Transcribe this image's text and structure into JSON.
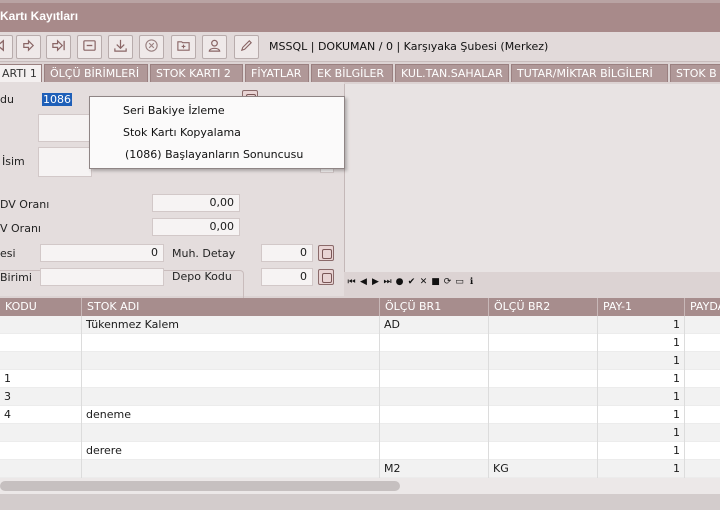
{
  "window": {
    "title": "Kartı Kayıtları"
  },
  "toolbar": {
    "buttons": [
      "back-icon",
      "forward-icon",
      "forward-end-icon",
      "minus-icon",
      "download-icon",
      "cancel-icon",
      "add-icon",
      "user-icon",
      "edit-icon"
    ],
    "info": "MSSQL | DOKUMAN / 0 | Karşıyaka Şubesi (Merkez)"
  },
  "tabs": [
    {
      "label": "ARTI 1",
      "active": true
    },
    {
      "label": "ÖLÇÜ BİRİMLERİ"
    },
    {
      "label": "STOK KARTI 2"
    },
    {
      "label": "FİYATLAR"
    },
    {
      "label": "EK BİLGİLER"
    },
    {
      "label": "KUL.TAN.SAHALAR"
    },
    {
      "label": "TUTAR/MİKTAR BİLGİLERİ"
    },
    {
      "label": "STOK B"
    }
  ],
  "form": {
    "code_label": "du",
    "code_value": "1086",
    "name_label": "İsim",
    "kdv1_label": "DV Oranı",
    "kdv1_value": "0,00",
    "kdv2_label": "V Oranı",
    "kdv2_value": "0,00",
    "field3_label": "esi",
    "field3_value": "0",
    "muh_label": "Muh. Detay",
    "muh_value": "0",
    "unit_label": "Birimi",
    "depo_label": "Depo Kodu",
    "depo_value": "0"
  },
  "context_menu": {
    "items": [
      "Seri Bakiye İzleme",
      "Stok Kartı Kopyalama",
      "(1086) Başlayanların Sonuncusu"
    ]
  },
  "navigator": [
    "⏮",
    "◀",
    "▶",
    "⏭",
    "●",
    "✔",
    "✕",
    "■",
    "⟳",
    "▭",
    "ℹ"
  ],
  "grid": {
    "columns": [
      "KODU",
      "STOK ADI",
      "ÖLÇÜ BR1",
      "ÖLÇÜ BR2",
      "PAY-1",
      "PAYDA"
    ],
    "rows": [
      {
        "kod": "",
        "ad": "Tükenmez Kalem",
        "br1": "AD",
        "br2": "",
        "pay": "1"
      },
      {
        "kod": "",
        "ad": "",
        "br1": "",
        "br2": "",
        "pay": "1"
      },
      {
        "kod": "",
        "ad": "",
        "br1": "",
        "br2": "",
        "pay": "1"
      },
      {
        "kod": "1",
        "ad": "",
        "br1": "",
        "br2": "",
        "pay": "1"
      },
      {
        "kod": "3",
        "ad": "",
        "br1": "",
        "br2": "",
        "pay": "1"
      },
      {
        "kod": "4",
        "ad": "deneme",
        "br1": "",
        "br2": "",
        "pay": "1"
      },
      {
        "kod": "",
        "ad": "",
        "br1": "",
        "br2": "",
        "pay": "1"
      },
      {
        "kod": "",
        "ad": "derere",
        "br1": "",
        "br2": "",
        "pay": "1"
      },
      {
        "kod": "",
        "ad": "",
        "br1": "M2",
        "br2": "KG",
        "pay": "1"
      },
      {
        "kod": "",
        "ad": "",
        "br1": "",
        "br2": "",
        "pay": ""
      }
    ]
  }
}
